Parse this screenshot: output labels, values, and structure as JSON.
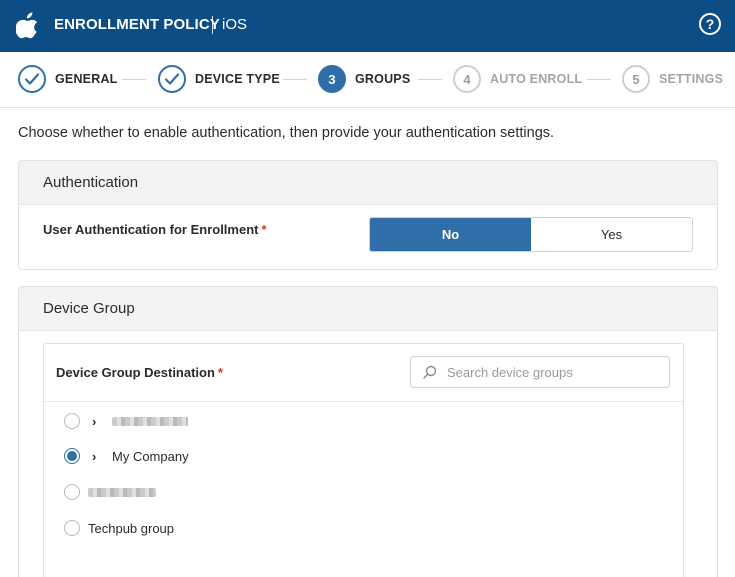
{
  "header": {
    "title": "ENROLLMENT POLICY",
    "platform": "iOS",
    "help_glyph": "?",
    "bg_color": "#0d4d86"
  },
  "stepper": {
    "steps": [
      {
        "number": "1",
        "label": "GENERAL",
        "state": "done"
      },
      {
        "number": "2",
        "label": "DEVICE TYPE",
        "state": "done"
      },
      {
        "number": "3",
        "label": "GROUPS",
        "state": "active"
      },
      {
        "number": "4",
        "label": "AUTO ENROLL",
        "state": "pending"
      },
      {
        "number": "5",
        "label": "SETTINGS",
        "state": "pending"
      }
    ],
    "accent_color": "#2f6ea8"
  },
  "intro": "Choose whether to enable authentication, then provide your authentication settings.",
  "authentication": {
    "title": "Authentication",
    "field_label": "User Authentication for Enrollment",
    "required_mark": "*",
    "options": [
      "No",
      "Yes"
    ],
    "selected": "No"
  },
  "device_group": {
    "title": "Device Group",
    "field_label": "Device Group Destination",
    "required_mark": "*",
    "search_placeholder": "Search device groups",
    "items": [
      {
        "label": "",
        "redacted": true,
        "expandable": true,
        "selected": false
      },
      {
        "label": "My Company",
        "redacted": false,
        "expandable": true,
        "selected": true
      },
      {
        "label": "",
        "redacted": true,
        "expandable": false,
        "selected": false
      },
      {
        "label": "Techpub group",
        "redacted": false,
        "expandable": false,
        "selected": false
      }
    ]
  }
}
